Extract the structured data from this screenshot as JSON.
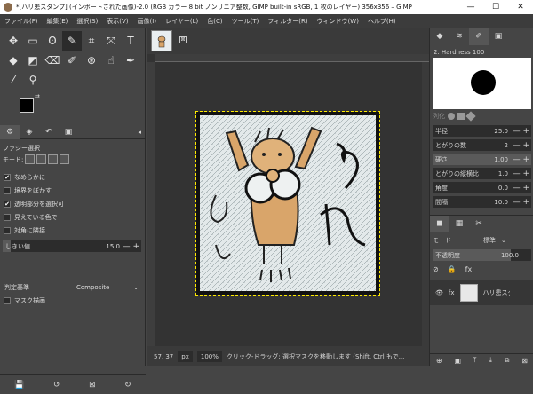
{
  "window": {
    "title": "*[ハリ患スタンプ] (インポートされた画像)-2.0 (RGB カラー 8 bit ノンリニア整数, GIMP built-in sRGB, 1 枚のレイヤー) 356x356 – GIMP",
    "minimize": "—",
    "maximize": "☐",
    "close": "✕"
  },
  "menubar": [
    "ファイル(F)",
    "編集(E)",
    "選択(S)",
    "表示(V)",
    "画像(I)",
    "レイヤー(L)",
    "色(C)",
    "ツール(T)",
    "フィルター(R)",
    "ウィンドウ(W)",
    "ヘルプ(H)"
  ],
  "toolbox": {
    "icons": [
      {
        "name": "move-tool-icon",
        "glyph": "✥",
        "active": false
      },
      {
        "name": "rect-select-tool-icon",
        "glyph": "▭",
        "active": false
      },
      {
        "name": "lasso-tool-icon",
        "glyph": "ʘ",
        "active": false
      },
      {
        "name": "fuzzy-select-tool-icon",
        "glyph": "✎",
        "active": true
      },
      {
        "name": "crop-tool-icon",
        "glyph": "⌗",
        "active": false
      },
      {
        "name": "transform-tool-icon",
        "glyph": "⤧",
        "active": false
      },
      {
        "name": "text-tool-icon",
        "glyph": "T",
        "active": false
      },
      {
        "name": "bucket-fill-tool-icon",
        "glyph": "◆",
        "active": false
      },
      {
        "name": "gradient-tool-icon",
        "glyph": "◩",
        "active": false
      },
      {
        "name": "eraser-tool-icon",
        "glyph": "⌫",
        "active": false
      },
      {
        "name": "paintbrush-tool-icon",
        "glyph": "✐",
        "active": false
      },
      {
        "name": "clone-tool-icon",
        "glyph": "⊛",
        "active": false
      },
      {
        "name": "smudge-tool-icon",
        "glyph": "☝",
        "active": false
      },
      {
        "name": "path-tool-icon",
        "glyph": "✒",
        "active": false
      },
      {
        "name": "color-picker-tool-icon",
        "glyph": "⁄",
        "active": false
      },
      {
        "name": "zoom-tool-icon",
        "glyph": "⚲",
        "active": false
      }
    ]
  },
  "tool_options": {
    "tabs": [
      "⚙",
      "◈",
      "↶",
      "▣"
    ],
    "tab_menu": "◂",
    "title": "ファジー選択",
    "mode_label": "モード:",
    "checkboxes": [
      {
        "label": "なめらかに",
        "checked": true
      },
      {
        "label": "境界をぼかす",
        "checked": false
      },
      {
        "label": "透明部分を選択可",
        "checked": true
      },
      {
        "label": "見えている色で",
        "checked": false
      },
      {
        "label": "対角に隣接",
        "checked": false
      }
    ],
    "threshold_label": "しきい値",
    "threshold_value": "15.0",
    "threshold_fraction": 0.06,
    "criterion_label": "判定基準",
    "criterion_value": "Composite",
    "draw_mask": {
      "label": "マスク描画",
      "checked": false
    },
    "bottom_buttons": [
      "💾",
      "↺",
      "⊠",
      "↻"
    ]
  },
  "image": {
    "tab_close": "⊠"
  },
  "status": {
    "coords": "57, 37",
    "unit": "px",
    "zoom": "100%",
    "message": "クリック-ドラッグ: 選択マスクを移動します (Shift, Ctrl もで..."
  },
  "brushes": {
    "tabs": [
      "◆",
      "≋",
      "✐",
      "▣"
    ],
    "name": "2. Hardness 100",
    "tag_hint": "列化",
    "settings": [
      {
        "label": "半径",
        "value": "25.0"
      },
      {
        "label": "とがりの数",
        "value": "2"
      },
      {
        "label": "硬さ",
        "value": "1.00"
      },
      {
        "label": "とがりの縦横比",
        "value": "1.0"
      },
      {
        "label": "角度",
        "value": "0.0"
      },
      {
        "label": "間隔",
        "value": "10.0"
      }
    ]
  },
  "layers": {
    "tabs": [
      "◼",
      "▦",
      "✂"
    ],
    "mode_label": "モード",
    "mode_value": "標準",
    "opacity_label": "不透明度",
    "opacity_value": "100.0",
    "lock_icons": [
      "⊘",
      "🔒",
      "fx"
    ],
    "layer_name": "ハリ患スタンプ",
    "layer_fx": "fx",
    "eye": "👁",
    "bottom_buttons": [
      "⊕",
      "▣",
      "⤒",
      "⤓",
      "⧉",
      "⊠"
    ]
  }
}
